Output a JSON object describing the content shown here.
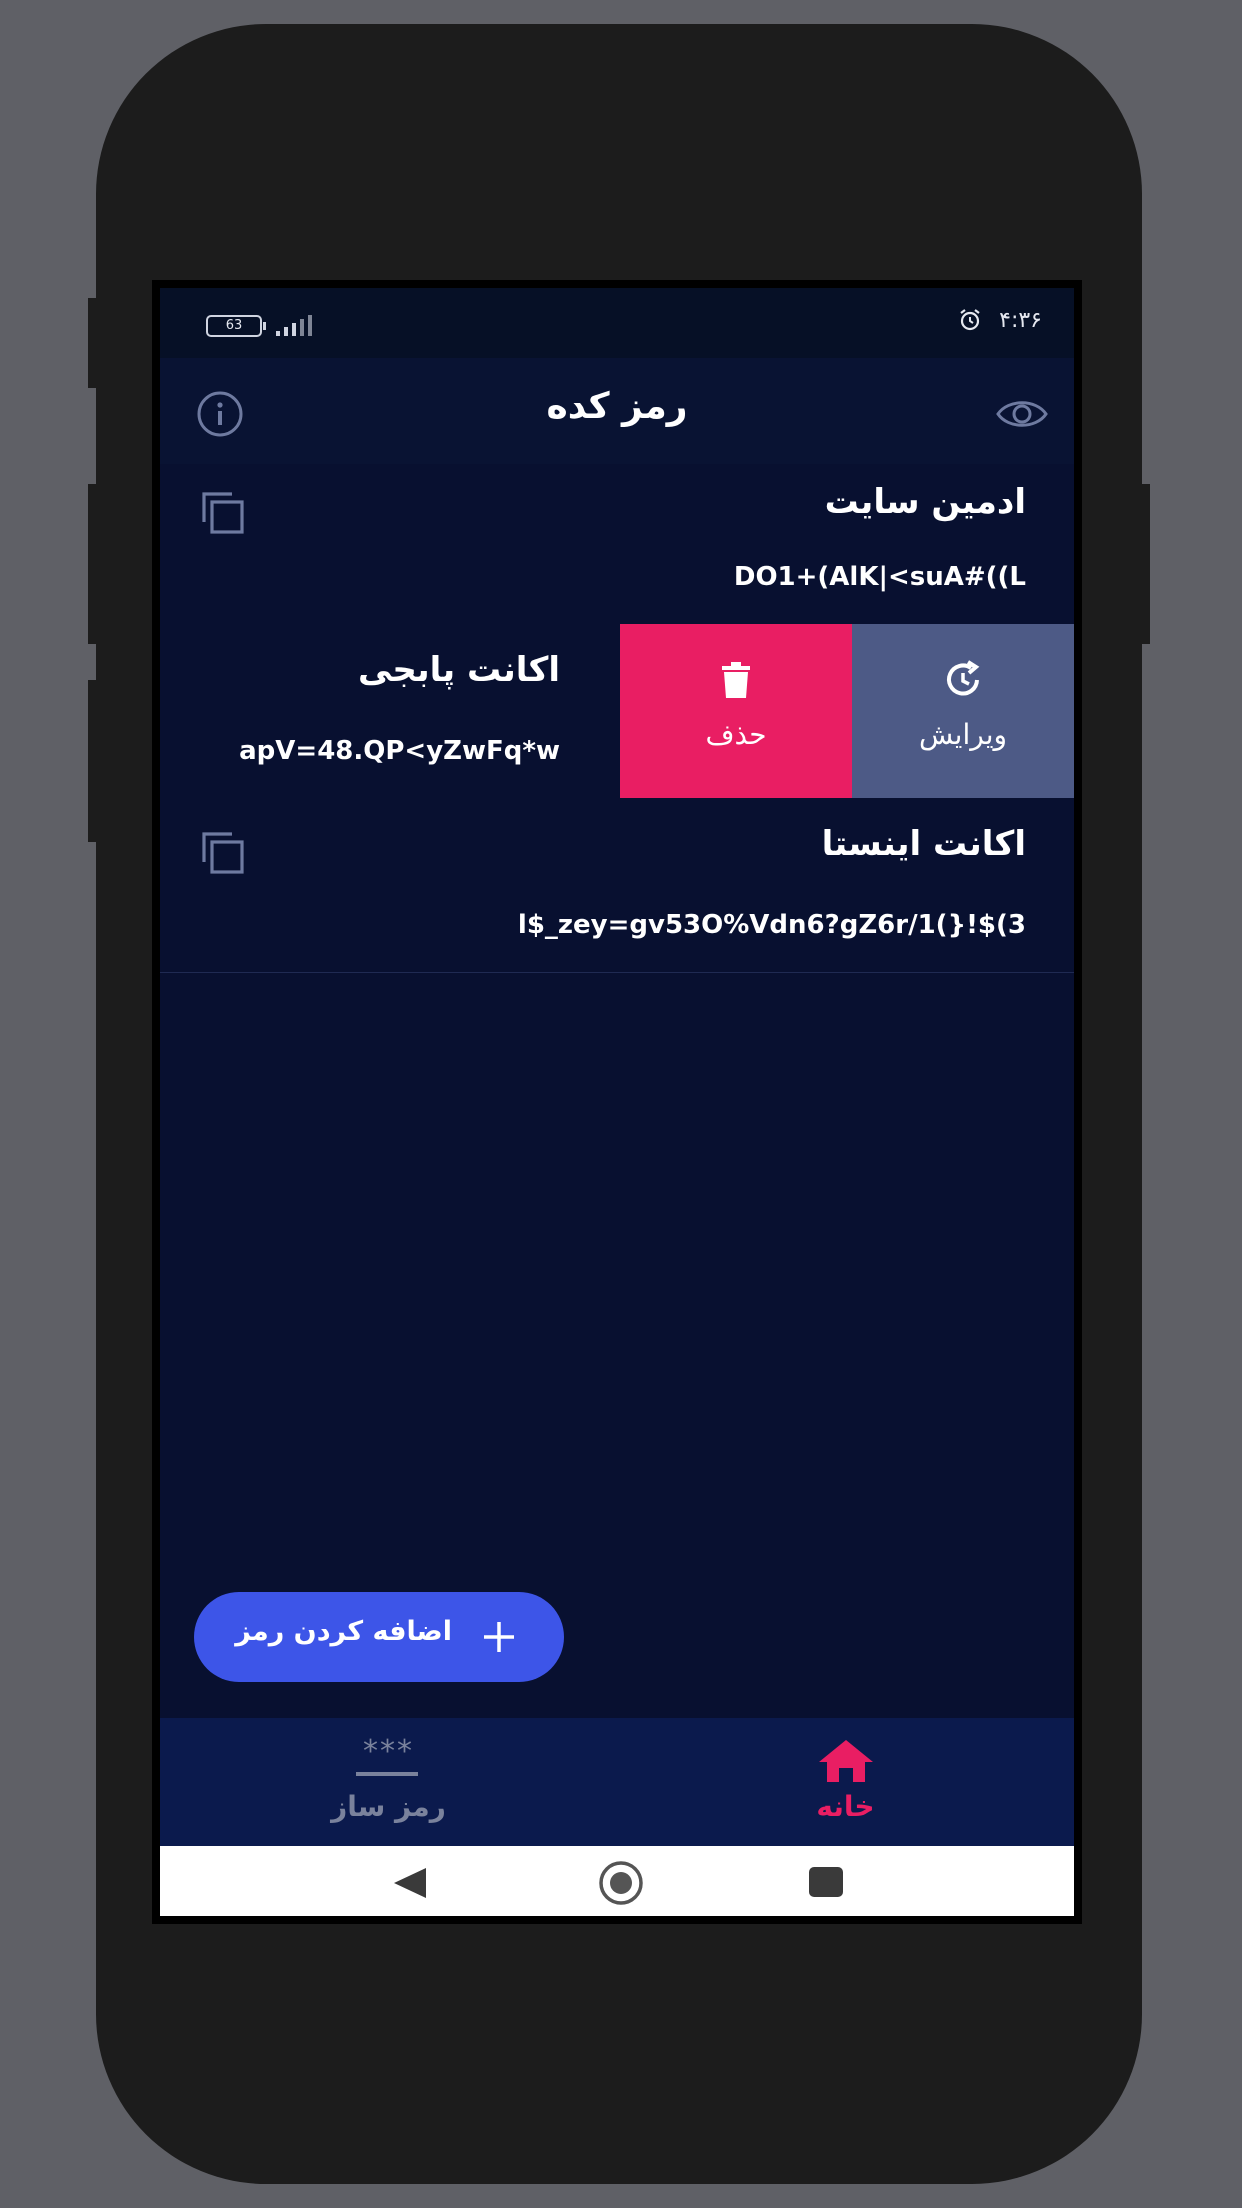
{
  "status_bar": {
    "battery": "63",
    "time": "۴:۳۶"
  },
  "app_bar": {
    "title": "رمز کده",
    "left_icon": "info-icon",
    "right_icon": "eye-icon"
  },
  "entries": [
    {
      "name": "ادمین سایت",
      "password": "DO1+(AlK|<suA#((L"
    },
    {
      "name": "اکانت پابجی",
      "password": "apV=48.QP<yZwFq*w"
    },
    {
      "name": "اکانت اینستا",
      "password": "l$_zey=gv53O%Vdn6?gZ6r/1(}!$(3"
    }
  ],
  "swipe_actions": {
    "delete_label": "حذف",
    "edit_label": "ویرایش",
    "delete_color": "#e91e63",
    "edit_color": "#4d5a86"
  },
  "fab": {
    "label": "اضافه کردن رمز",
    "color": "#3d55e8"
  },
  "bottom_nav": {
    "items": [
      {
        "label": "رمز ساز",
        "icon": "asterisks-icon",
        "active": false
      },
      {
        "label": "خانه",
        "icon": "home-icon",
        "active": true
      }
    ],
    "active_color": "#e91e63",
    "inactive_color": "#7a829c",
    "stars": "***"
  }
}
